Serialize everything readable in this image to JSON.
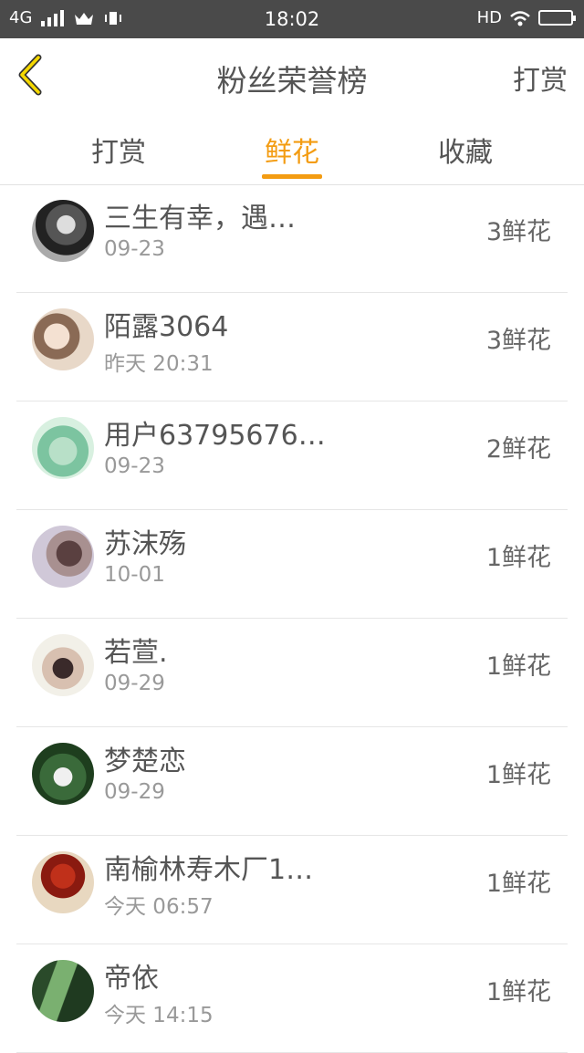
{
  "status_bar": {
    "network": "4G",
    "time": "18:02",
    "hd": "HD"
  },
  "nav": {
    "title": "粉丝荣誉榜",
    "right_label": "打赏"
  },
  "tabs": [
    {
      "label": "打赏",
      "active": false
    },
    {
      "label": "鲜花",
      "active": true
    },
    {
      "label": "收藏",
      "active": false
    }
  ],
  "accent_color": "#f39c12",
  "list": [
    {
      "name": "三生有幸，遇…",
      "date": "09-23",
      "count": "3鲜花"
    },
    {
      "name": "陌露3064",
      "date": "昨天 20:31",
      "count": "3鲜花"
    },
    {
      "name": "用户63795676…",
      "date": "09-23",
      "count": "2鲜花"
    },
    {
      "name": "苏沫殇",
      "date": "10-01",
      "count": "1鲜花"
    },
    {
      "name": "若萱.",
      "date": "09-29",
      "count": "1鲜花"
    },
    {
      "name": "梦楚恋",
      "date": "09-29",
      "count": "1鲜花"
    },
    {
      "name": "南榆林寿木厂1…",
      "date": "今天 06:57",
      "count": "1鲜花"
    },
    {
      "name": "帝依",
      "date": "今天 14:15",
      "count": "1鲜花"
    }
  ]
}
